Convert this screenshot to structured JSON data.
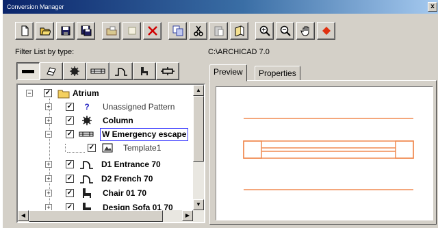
{
  "window": {
    "title": "Conversion Manager",
    "close_glyph": "x"
  },
  "toolbar": {
    "buttons": [
      {
        "name": "new-icon"
      },
      {
        "name": "open-icon"
      },
      {
        "name": "save-icon"
      },
      {
        "name": "save-as-icon"
      },
      {
        "name": "folder-import-icon"
      },
      {
        "name": "blank-page-icon"
      },
      {
        "name": "delete-icon"
      },
      {
        "name": "copy-icon"
      },
      {
        "name": "cut-icon"
      },
      {
        "name": "paste-icon"
      },
      {
        "name": "help-icon"
      },
      {
        "name": "zoom-in-icon"
      },
      {
        "name": "zoom-out-icon"
      },
      {
        "name": "pan-hand-icon"
      },
      {
        "name": "stop-icon"
      }
    ],
    "accent_delete": "#d00000"
  },
  "filter": {
    "label": "Filter List by type:",
    "buttons": [
      {
        "name": "filter-all-icon"
      },
      {
        "name": "filter-slab-icon"
      },
      {
        "name": "filter-object-icon"
      },
      {
        "name": "filter-window-icon"
      },
      {
        "name": "filter-door-icon"
      },
      {
        "name": "filter-furniture-icon"
      },
      {
        "name": "filter-lamp-icon"
      }
    ]
  },
  "path": {
    "label": "C:\\ARCHICAD 7.0"
  },
  "tree": {
    "nodes": [
      {
        "label": "Atrium",
        "level": 0,
        "expander": "−",
        "checked": true,
        "icon": "folder-icon"
      },
      {
        "label": "Unassigned Pattern",
        "level": 1,
        "expander": "+",
        "checked": true,
        "icon": "question-icon",
        "style": "normal"
      },
      {
        "label": "Column",
        "level": 1,
        "expander": "+",
        "checked": true,
        "icon": "gear-icon"
      },
      {
        "label": "W Emergency escape",
        "level": 1,
        "expander": "−",
        "checked": true,
        "icon": "window-icon",
        "style": "editing"
      },
      {
        "label": "Template1",
        "level": 2,
        "expander": "",
        "checked": true,
        "icon": "template-icon",
        "style": "normal"
      },
      {
        "label": "D1 Entrance 70",
        "level": 1,
        "expander": "+",
        "checked": true,
        "icon": "door-icon"
      },
      {
        "label": "D2 French 70",
        "level": 1,
        "expander": "+",
        "checked": true,
        "icon": "door-icon"
      },
      {
        "label": "Chair 01 70",
        "level": 1,
        "expander": "+",
        "checked": true,
        "icon": "chair-icon"
      },
      {
        "label": "Design Sofa 01 70",
        "level": 1,
        "expander": "+",
        "checked": true,
        "icon": "chair-icon"
      }
    ],
    "check_glyph": "✓"
  },
  "tabs": [
    {
      "label": "Preview",
      "active": true
    },
    {
      "label": "Properties",
      "active": false
    }
  ],
  "preview": {
    "line_color": "#f08a50"
  }
}
